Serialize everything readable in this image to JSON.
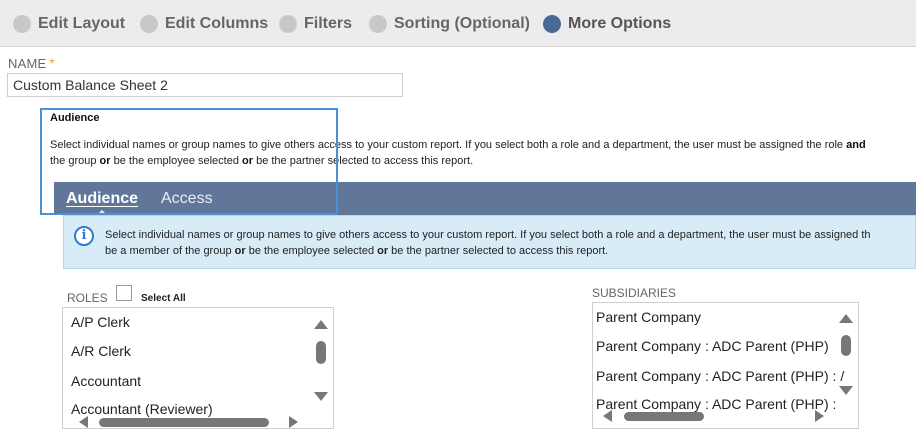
{
  "steps": [
    {
      "label": "Edit Layout"
    },
    {
      "label": "Edit Columns"
    },
    {
      "label": "Filters"
    },
    {
      "label": "Sorting (Optional)"
    },
    {
      "label": "More Options"
    }
  ],
  "name_field": {
    "label": "NAME",
    "required_mark": "*",
    "value": "Custom Balance Sheet 2"
  },
  "audience_section": {
    "title": "Audience",
    "help_line1_text": "Select individual names or group names to give others access to your custom report. If you select both a role and a department, the user must be assigned the role ",
    "help_line1_bold": "and",
    "help_line2_a": "the group ",
    "help_line2_b": " be the employee selected ",
    "help_line2_c": " be the partner selected to access this report.",
    "or": "or"
  },
  "tabs": [
    {
      "label": "Audience",
      "underline_char": "A"
    },
    {
      "label": "Access",
      "underline_char": "c"
    }
  ],
  "info_banner": {
    "icon": "info-icon",
    "line1": "Select individual names or group names to give others access to your custom report. If you select both a role and a department, the user must be assigned th",
    "line2_a": "be a member of the group ",
    "line2_b": " be the employee selected ",
    "line2_c": " be the partner selected to access this report.",
    "or": "or"
  },
  "roles": {
    "label": "ROLES",
    "select_all_label": "Select All",
    "items": [
      "A/P Clerk",
      "A/R Clerk",
      "Accountant",
      "Accountant (Reviewer)"
    ]
  },
  "subsidiaries": {
    "label": "SUBSIDIARIES",
    "items": [
      "Parent Company",
      "Parent Company : ADC Parent (PHP)",
      "Parent Company : ADC Parent (PHP) : /",
      "Parent Company : ADC Parent (PHP) : "
    ]
  },
  "colors": {
    "tab_bar": "#607799",
    "active_step": "#476a96",
    "info_background": "#d8ecf7",
    "highlight_border": "#4a90d4"
  }
}
